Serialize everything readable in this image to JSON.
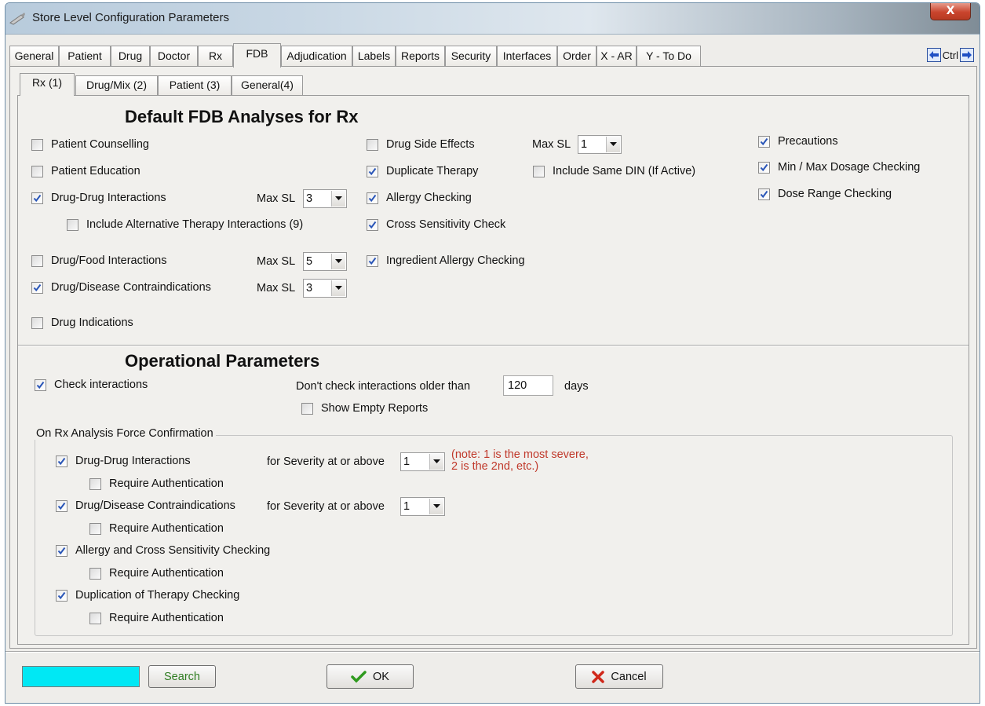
{
  "window": {
    "title": "Store Level Configuration Parameters",
    "close_label": "X"
  },
  "main_tabs": [
    "General",
    "Patient",
    "Drug",
    "Doctor",
    "Rx",
    "FDB",
    "Adjudication",
    "Labels",
    "Reports",
    "Security",
    "Interfaces",
    "Order",
    "X - AR",
    "Y - To Do"
  ],
  "active_main_tab": "FDB",
  "ctrl_nav_label": "Ctrl",
  "sub_tabs": [
    "Rx (1)",
    "Drug/Mix (2)",
    "Patient (3)",
    "General(4)"
  ],
  "active_sub_tab": "Rx (1)",
  "fdb": {
    "title": "Default FDB Analyses for Rx",
    "col1": {
      "patient_counselling": {
        "label": "Patient Counselling",
        "checked": false
      },
      "patient_education": {
        "label": "Patient Education",
        "checked": false
      },
      "drug_drug": {
        "label": "Drug-Drug Interactions",
        "checked": true,
        "maxsl_label": "Max SL",
        "maxsl": "3"
      },
      "alt_therapy": {
        "label": "Include Alternative Therapy Interactions (9)",
        "checked": false
      },
      "drug_food": {
        "label": "Drug/Food Interactions",
        "checked": false,
        "maxsl_label": "Max SL",
        "maxsl": "5"
      },
      "drug_disease": {
        "label": "Drug/Disease Contraindications",
        "checked": true,
        "maxsl_label": "Max SL",
        "maxsl": "3"
      },
      "drug_indications": {
        "label": "Drug Indications",
        "checked": false
      }
    },
    "col2": {
      "side_effects": {
        "label": "Drug Side Effects",
        "checked": false,
        "maxsl_label": "Max SL",
        "maxsl": "1"
      },
      "duplicate_therapy": {
        "label": "Duplicate Therapy",
        "checked": true
      },
      "same_din": {
        "label": "Include Same DIN (If Active)",
        "checked": false
      },
      "allergy": {
        "label": "Allergy Checking",
        "checked": true
      },
      "cross_sensitivity": {
        "label": "Cross Sensitivity Check",
        "checked": true
      },
      "ingredient_allergy": {
        "label": "Ingredient Allergy Checking",
        "checked": true
      }
    },
    "col3": {
      "precautions": {
        "label": "Precautions",
        "checked": true
      },
      "min_max": {
        "label": "Min / Max Dosage Checking",
        "checked": true
      },
      "dose_range": {
        "label": "Dose Range Checking",
        "checked": true
      }
    }
  },
  "operational": {
    "title": "Operational Parameters",
    "check_interactions": {
      "label": "Check interactions",
      "checked": true
    },
    "older_than_label": "Don't check interactions older than",
    "older_than_value": "120",
    "days_label": "days",
    "show_empty": {
      "label": "Show Empty Reports",
      "checked": false
    }
  },
  "force_confirmation": {
    "legend": "On Rx Analysis Force Confirmation",
    "severity_label": "for Severity at or above",
    "note_line1": "(note: 1 is the most severe,",
    "note_line2": "2 is the 2nd, etc.)",
    "require_auth_label": "Require Authentication",
    "items": [
      {
        "label": "Drug-Drug Interactions",
        "checked": true,
        "severity": "1",
        "auth": false
      },
      {
        "label": "Drug/Disease Contraindications",
        "checked": true,
        "severity": "1",
        "auth": false
      },
      {
        "label": "Allergy and Cross Sensitivity Checking",
        "checked": true,
        "auth": false
      },
      {
        "label": "Duplication of Therapy Checking",
        "checked": true,
        "auth": false
      }
    ]
  },
  "footer": {
    "search_value": "",
    "search_button": "Search",
    "ok_button": "OK",
    "cancel_button": "Cancel"
  },
  "colors": {
    "search_field": "#00e8f4",
    "note_text": "#c0392b",
    "check_mark": "#2a56b8",
    "ok_check": "#2f9a1e",
    "cancel_x": "#d0281a"
  }
}
